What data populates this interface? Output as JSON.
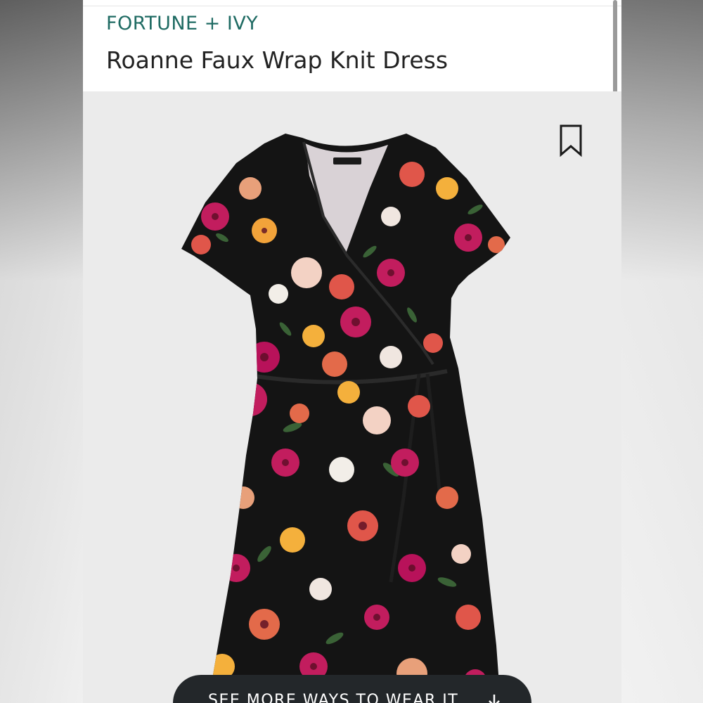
{
  "header": {
    "brand": "FORTUNE + IVY",
    "product_name": "Roanne Faux Wrap Knit Dress"
  },
  "image": {
    "subject_icon": "dress-photo",
    "bookmark_icon": "bookmark-icon"
  },
  "cta": {
    "label": "SEE MORE WAYS TO WEAR IT",
    "icon": "arrow-down-icon"
  },
  "colors": {
    "brand": "#1f6b63",
    "title": "#222222",
    "cta_background": "#23272a",
    "image_background": "#ebebeb"
  }
}
